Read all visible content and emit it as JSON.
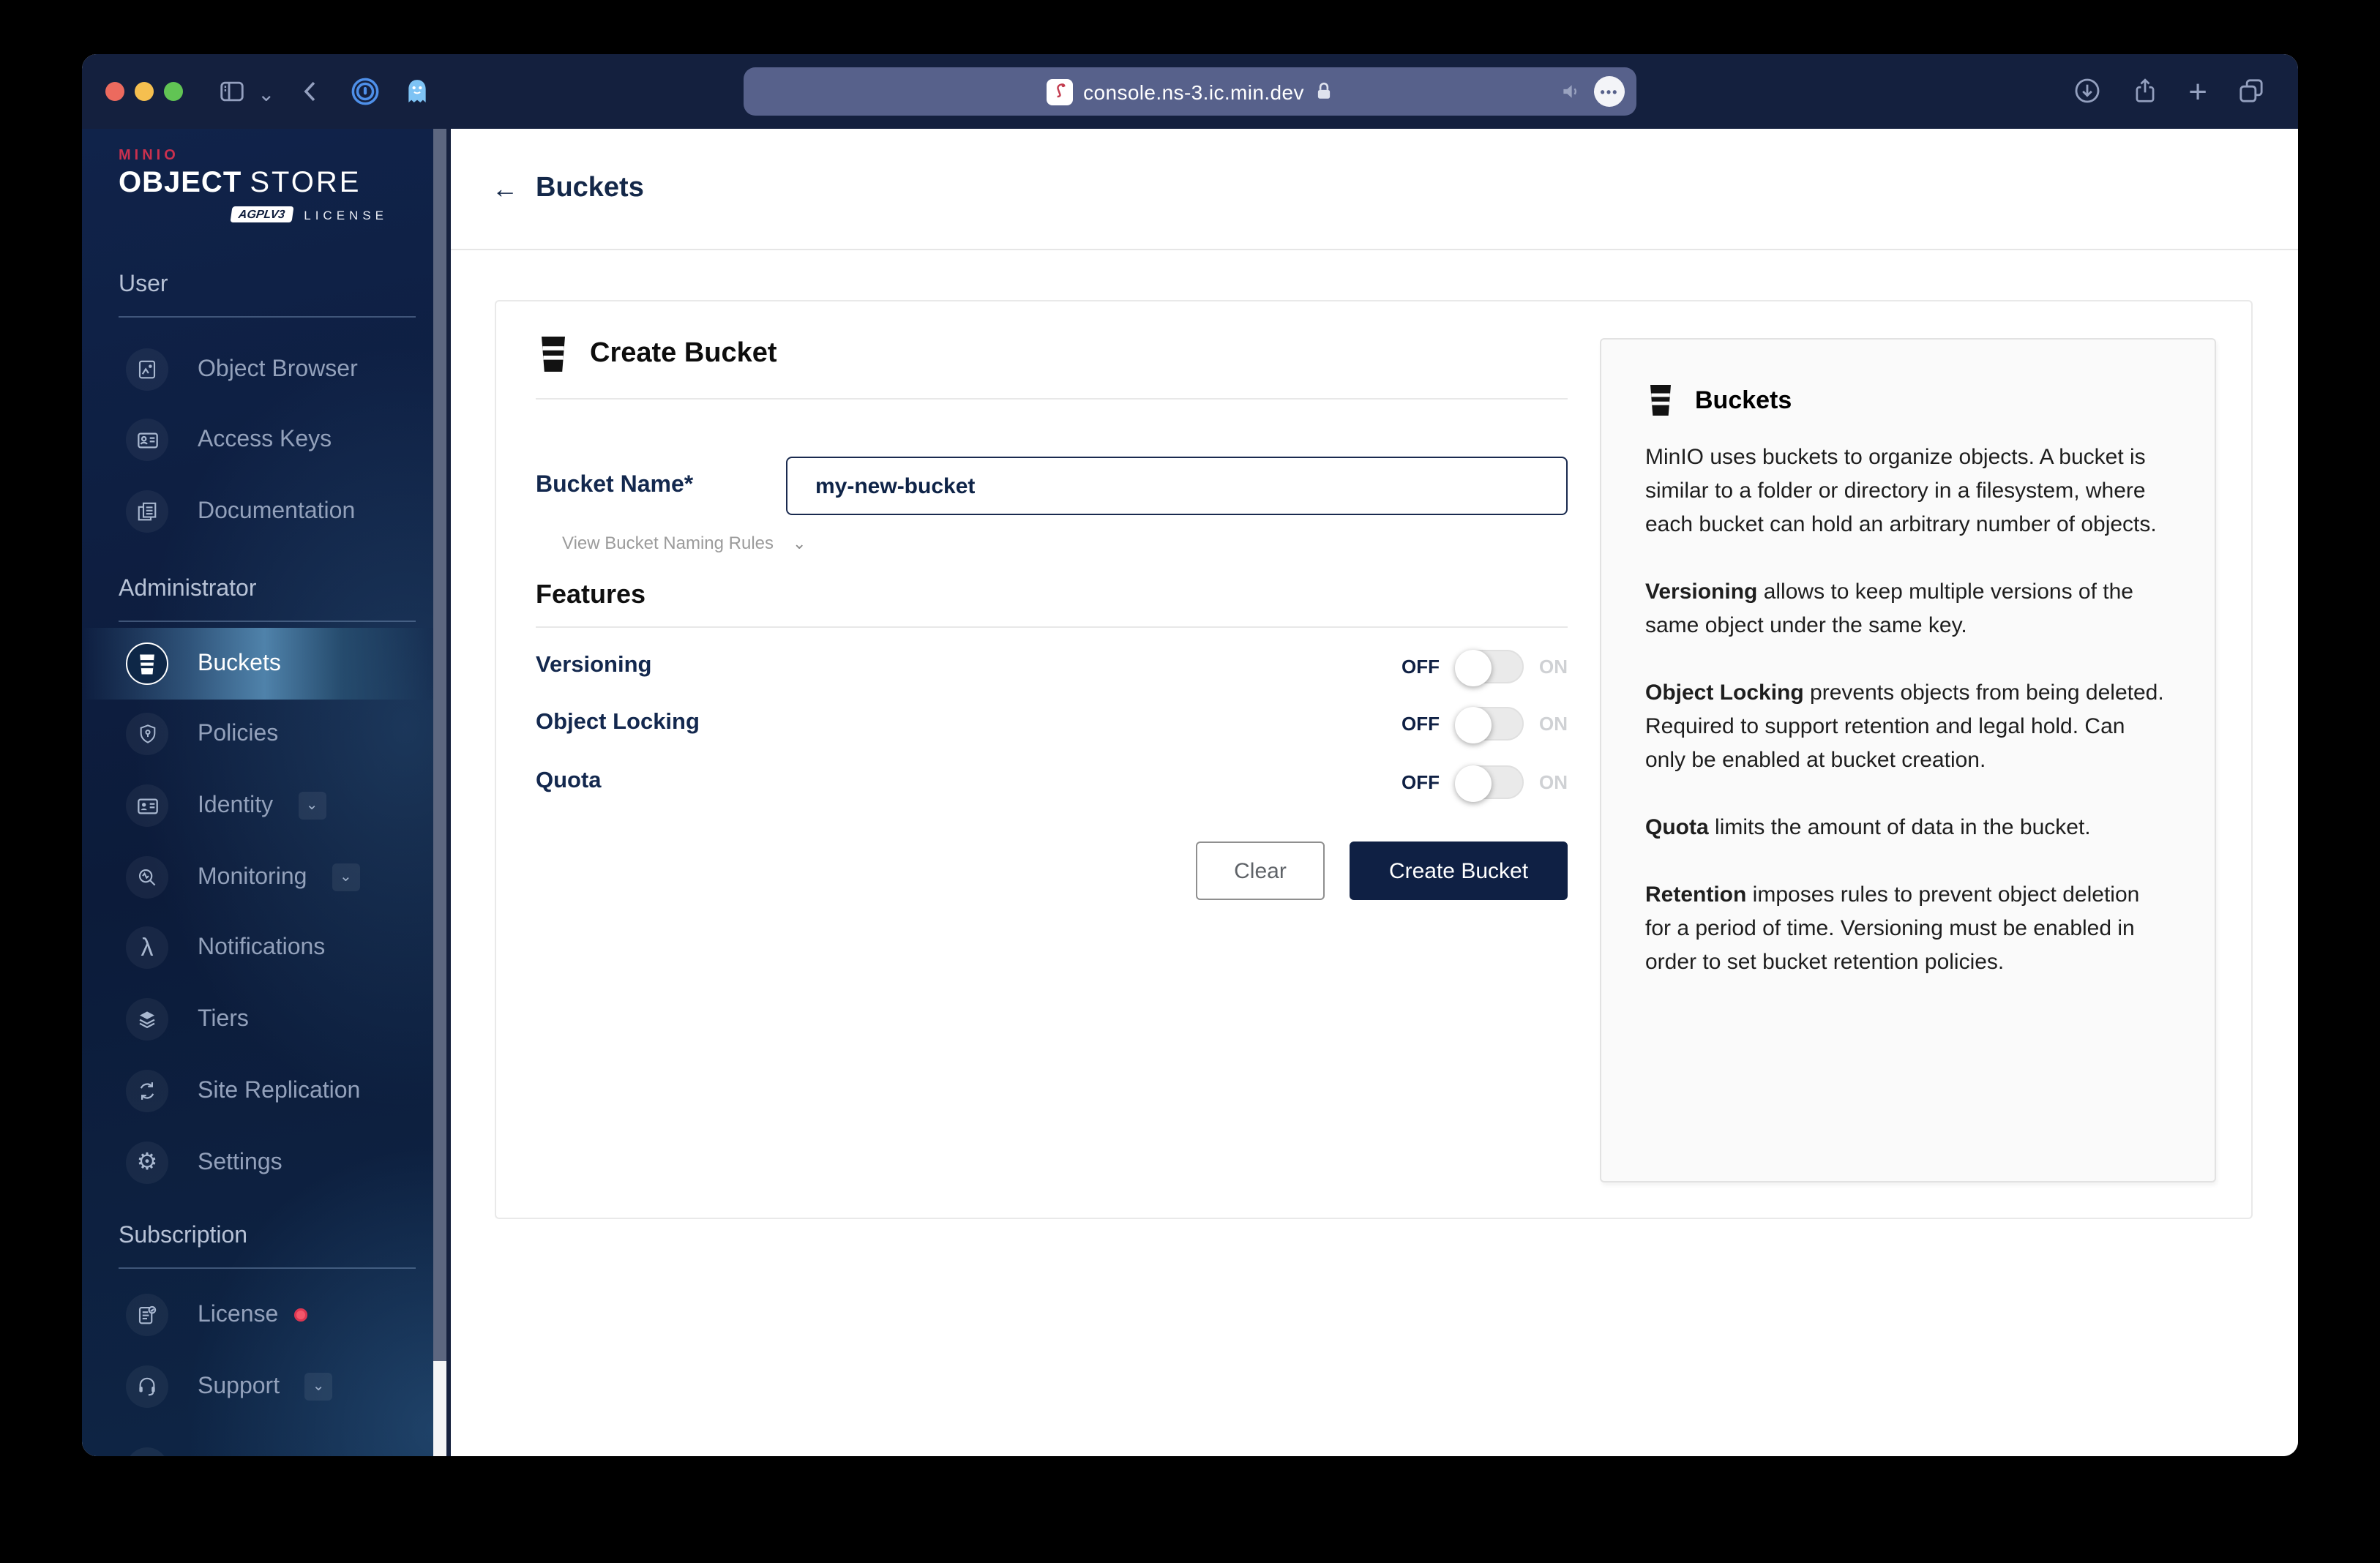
{
  "browser": {
    "url": "console.ns-3.ic.min.dev",
    "window_controls": [
      "close",
      "minimize",
      "zoom"
    ]
  },
  "icons": {
    "chevron_down": "⌄",
    "back_arrow": "←",
    "plus": "+",
    "lambda": "λ",
    "gear": "⚙",
    "ellipsis": "•••"
  },
  "colors": {
    "titlebar": "#14203e",
    "sidebar_dark": "#0c1b3a",
    "selected_highlight": "#4f82aa",
    "accent_navy": "#0f2044",
    "brand_red": "#c9304e",
    "license_badge_dot": "#f4566a"
  },
  "sidebar": {
    "logo": {
      "brand": "MINIO",
      "title_primary": "OBJECT",
      "title_secondary": "STORE",
      "badge": "AGPLV3",
      "license": "LICENSE"
    },
    "sections": [
      {
        "label": "User",
        "items": [
          {
            "label": "Object Browser"
          },
          {
            "label": "Access Keys"
          },
          {
            "label": "Documentation"
          }
        ]
      },
      {
        "label": "Administrator",
        "items": [
          {
            "label": "Buckets",
            "selected": true
          },
          {
            "label": "Policies"
          },
          {
            "label": "Identity",
            "expandable": true
          },
          {
            "label": "Monitoring",
            "expandable": true
          },
          {
            "label": "Notifications"
          },
          {
            "label": "Tiers"
          },
          {
            "label": "Site Replication"
          },
          {
            "label": "Settings"
          }
        ]
      },
      {
        "label": "Subscription",
        "items": [
          {
            "label": "License",
            "badge": true
          },
          {
            "label": "Support",
            "expandable": true
          }
        ]
      }
    ]
  },
  "page": {
    "back_title": "Buckets"
  },
  "form": {
    "title": "Create Bucket",
    "bucket_name_label": "Bucket Name*",
    "bucket_name_value": "my-new-bucket",
    "naming_rules_label": "View Bucket Naming Rules",
    "features_title": "Features",
    "off_label": "OFF",
    "on_label": "ON",
    "toggles": [
      {
        "label": "Versioning",
        "state": "OFF"
      },
      {
        "label": "Object Locking",
        "state": "OFF"
      },
      {
        "label": "Quota",
        "state": "OFF"
      }
    ],
    "clear_label": "Clear",
    "submit_label": "Create Bucket"
  },
  "help": {
    "title": "Buckets",
    "paragraphs": [
      {
        "bold": "",
        "text": "MinIO uses buckets to organize objects. A bucket is similar to a folder or directory in a filesystem, where each bucket can hold an arbitrary number of objects."
      },
      {
        "bold": "Versioning",
        "text": " allows to keep multiple versions of the same object under the same key."
      },
      {
        "bold": "Object Locking",
        "text": " prevents objects from being deleted. Required to support retention and legal hold. Can only be enabled at bucket creation."
      },
      {
        "bold": "Quota",
        "text": " limits the amount of data in the bucket."
      },
      {
        "bold": "Retention",
        "text": " imposes rules to prevent object deletion for a period of time. Versioning must be enabled in order to set bucket retention policies."
      }
    ]
  }
}
